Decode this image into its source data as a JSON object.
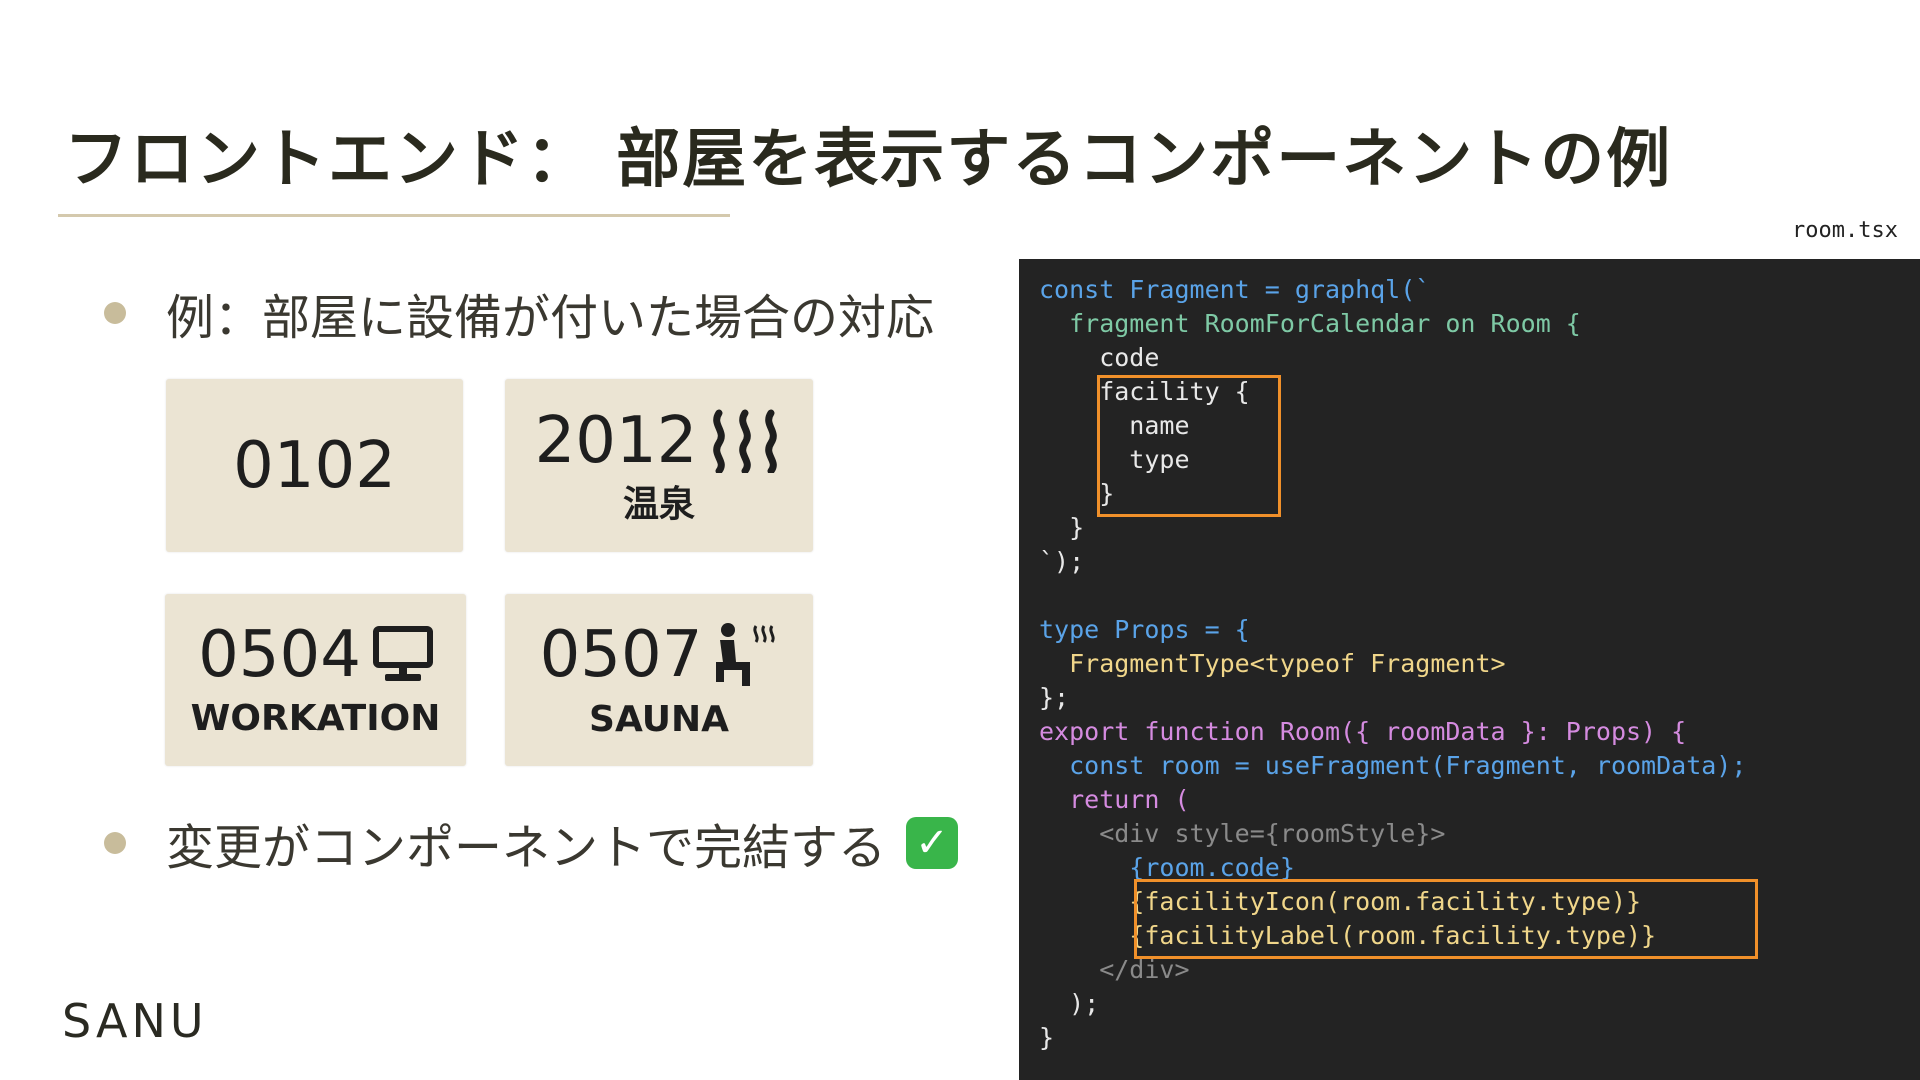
{
  "slide": {
    "title": "フロントエンド： 部屋を表示するコンポーネントの例",
    "bullet1": "例：部屋に設備が付いた場合の対応",
    "bullet2": "変更がコンポーネントで完結する",
    "bullet2_check": "✓",
    "logo": "SANU"
  },
  "cards": [
    {
      "number": "0102",
      "label": "",
      "icon": "none"
    },
    {
      "number": "2012",
      "label": "温泉",
      "icon": "hot-spring-icon"
    },
    {
      "number": "0504",
      "label": "WORKATION",
      "icon": "monitor-icon"
    },
    {
      "number": "0507",
      "label": "SAUNA",
      "icon": "sauna-person-icon"
    }
  ],
  "code": {
    "filename": "room.tsx",
    "lines": [
      "const Fragment = graphql(`",
      "  fragment RoomForCalendar on Room {",
      "    code",
      "    facility {",
      "      name",
      "      type",
      "    }",
      "  }",
      "`);",
      "",
      "type Props = {",
      "  FragmentType<typeof Fragment>",
      "};",
      "export function Room({ roomData }: Props) {",
      "  const room = useFragment(Fragment, roomData);",
      "  return (",
      "    <div style={roomStyle}>",
      "      {room.code}",
      "      {facilityIcon(room.facility.type)}",
      "      {facilityLabel(room.facility.type)}",
      "    </div>",
      "  );",
      "}"
    ]
  },
  "colors": {
    "accent_highlight": "#f0902a",
    "card_bg": "#ebe4d3",
    "code_bg": "#232323",
    "bullet_dot": "#c8bc9b"
  }
}
